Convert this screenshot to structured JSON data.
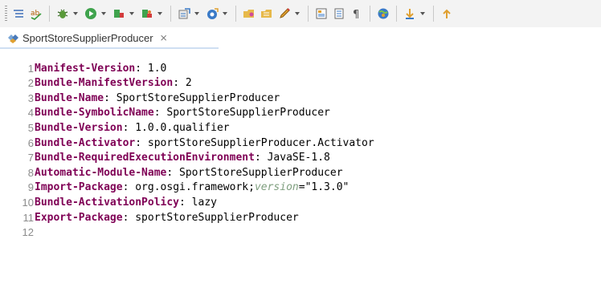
{
  "toolbar": {
    "buttons": [
      {
        "icon": "outline-icon"
      },
      {
        "icon": "spellcheck-icon"
      },
      {
        "icon": "debug-icon",
        "dropdown": true
      },
      {
        "icon": "run-icon",
        "dropdown": true
      },
      {
        "icon": "new-server-icon",
        "dropdown": true
      },
      {
        "icon": "new-connection-icon",
        "dropdown": true
      },
      {
        "icon": "new-type-icon",
        "dropdown": true
      },
      {
        "icon": "new-service-icon",
        "dropdown": true
      },
      {
        "icon": "open-folder-icon"
      },
      {
        "icon": "open-type-icon"
      },
      {
        "icon": "pencil-icon",
        "dropdown": true
      },
      {
        "icon": "toggle-markers-icon"
      },
      {
        "icon": "block-selection-icon"
      },
      {
        "icon": "show-whitespace-icon"
      },
      {
        "icon": "web-browser-icon"
      },
      {
        "icon": "next-annotation-icon",
        "dropdown": true
      }
    ],
    "colors": {
      "bg": "#f3f3f3"
    }
  },
  "editor_tab": {
    "label": "SportStoreSupplierProducer",
    "close_glyph": "⨯",
    "icon": "plugin-manifest-icon"
  },
  "editor": {
    "lines": [
      {
        "num": "1",
        "key": "Manifest-Version",
        "sep": ": ",
        "value": "1.0"
      },
      {
        "num": "2",
        "key": "Bundle-ManifestVersion",
        "sep": ": ",
        "value": "2"
      },
      {
        "num": "3",
        "key": "Bundle-Name",
        "sep": ": ",
        "value": "SportStoreSupplierProducer"
      },
      {
        "num": "4",
        "key": "Bundle-SymbolicName",
        "sep": ": ",
        "value": "SportStoreSupplierProducer"
      },
      {
        "num": "5",
        "key": "Bundle-Version",
        "sep": ": ",
        "value": "1.0.0.qualifier"
      },
      {
        "num": "6",
        "key": "Bundle-Activator",
        "sep": ": ",
        "value": "sportStoreSupplierProducer.Activator"
      },
      {
        "num": "7",
        "key": "Bundle-RequiredExecutionEnvironment",
        "sep": ": ",
        "value": "JavaSE-1.8"
      },
      {
        "num": "8",
        "key": "Automatic-Module-Name",
        "sep": ": ",
        "value": "SportStoreSupplierProducer"
      },
      {
        "num": "9",
        "key": "Import-Package",
        "sep": ": ",
        "value": "org.osgi.framework;",
        "attr": "version",
        "attr_eq": "=",
        "attr_val": "\"1.3.0\""
      },
      {
        "num": "10",
        "key": "Bundle-ActivationPolicy",
        "sep": ": ",
        "value": "lazy"
      },
      {
        "num": "11",
        "key": "Export-Package",
        "sep": ": ",
        "value": "sportStoreSupplierProducer"
      },
      {
        "num": "12",
        "key": "",
        "sep": "",
        "value": ""
      }
    ],
    "colors": {
      "key": "#7f0055",
      "attr": "#7f9f7f",
      "string": "#2a00ff",
      "line_number": "#8b8b8b"
    }
  }
}
